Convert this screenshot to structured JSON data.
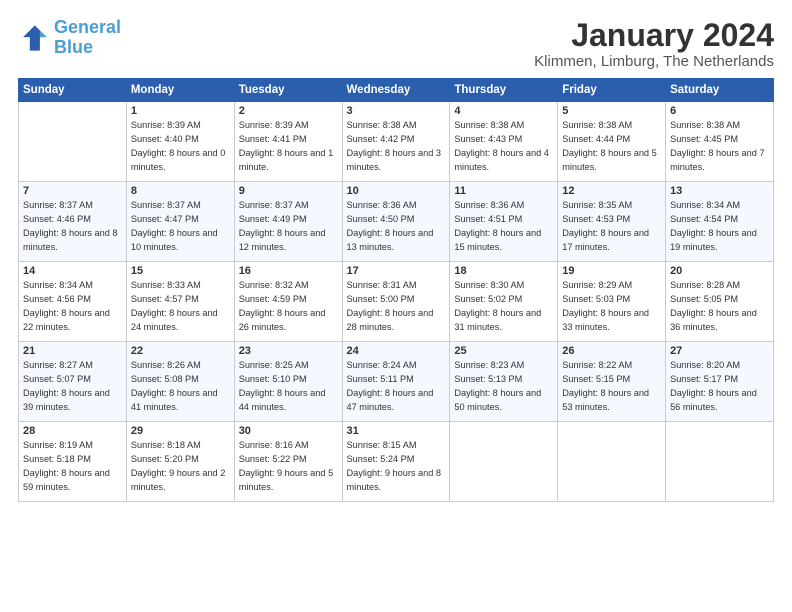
{
  "header": {
    "logo_line1": "General",
    "logo_line2": "Blue",
    "month_title": "January 2024",
    "location": "Klimmen, Limburg, The Netherlands"
  },
  "weekdays": [
    "Sunday",
    "Monday",
    "Tuesday",
    "Wednesday",
    "Thursday",
    "Friday",
    "Saturday"
  ],
  "weeks": [
    [
      {
        "day": "",
        "sunrise": "",
        "sunset": "",
        "daylight": ""
      },
      {
        "day": "1",
        "sunrise": "Sunrise: 8:39 AM",
        "sunset": "Sunset: 4:40 PM",
        "daylight": "Daylight: 8 hours and 0 minutes."
      },
      {
        "day": "2",
        "sunrise": "Sunrise: 8:39 AM",
        "sunset": "Sunset: 4:41 PM",
        "daylight": "Daylight: 8 hours and 1 minute."
      },
      {
        "day": "3",
        "sunrise": "Sunrise: 8:38 AM",
        "sunset": "Sunset: 4:42 PM",
        "daylight": "Daylight: 8 hours and 3 minutes."
      },
      {
        "day": "4",
        "sunrise": "Sunrise: 8:38 AM",
        "sunset": "Sunset: 4:43 PM",
        "daylight": "Daylight: 8 hours and 4 minutes."
      },
      {
        "day": "5",
        "sunrise": "Sunrise: 8:38 AM",
        "sunset": "Sunset: 4:44 PM",
        "daylight": "Daylight: 8 hours and 5 minutes."
      },
      {
        "day": "6",
        "sunrise": "Sunrise: 8:38 AM",
        "sunset": "Sunset: 4:45 PM",
        "daylight": "Daylight: 8 hours and 7 minutes."
      }
    ],
    [
      {
        "day": "7",
        "sunrise": "Sunrise: 8:37 AM",
        "sunset": "Sunset: 4:46 PM",
        "daylight": "Daylight: 8 hours and 8 minutes."
      },
      {
        "day": "8",
        "sunrise": "Sunrise: 8:37 AM",
        "sunset": "Sunset: 4:47 PM",
        "daylight": "Daylight: 8 hours and 10 minutes."
      },
      {
        "day": "9",
        "sunrise": "Sunrise: 8:37 AM",
        "sunset": "Sunset: 4:49 PM",
        "daylight": "Daylight: 8 hours and 12 minutes."
      },
      {
        "day": "10",
        "sunrise": "Sunrise: 8:36 AM",
        "sunset": "Sunset: 4:50 PM",
        "daylight": "Daylight: 8 hours and 13 minutes."
      },
      {
        "day": "11",
        "sunrise": "Sunrise: 8:36 AM",
        "sunset": "Sunset: 4:51 PM",
        "daylight": "Daylight: 8 hours and 15 minutes."
      },
      {
        "day": "12",
        "sunrise": "Sunrise: 8:35 AM",
        "sunset": "Sunset: 4:53 PM",
        "daylight": "Daylight: 8 hours and 17 minutes."
      },
      {
        "day": "13",
        "sunrise": "Sunrise: 8:34 AM",
        "sunset": "Sunset: 4:54 PM",
        "daylight": "Daylight: 8 hours and 19 minutes."
      }
    ],
    [
      {
        "day": "14",
        "sunrise": "Sunrise: 8:34 AM",
        "sunset": "Sunset: 4:56 PM",
        "daylight": "Daylight: 8 hours and 22 minutes."
      },
      {
        "day": "15",
        "sunrise": "Sunrise: 8:33 AM",
        "sunset": "Sunset: 4:57 PM",
        "daylight": "Daylight: 8 hours and 24 minutes."
      },
      {
        "day": "16",
        "sunrise": "Sunrise: 8:32 AM",
        "sunset": "Sunset: 4:59 PM",
        "daylight": "Daylight: 8 hours and 26 minutes."
      },
      {
        "day": "17",
        "sunrise": "Sunrise: 8:31 AM",
        "sunset": "Sunset: 5:00 PM",
        "daylight": "Daylight: 8 hours and 28 minutes."
      },
      {
        "day": "18",
        "sunrise": "Sunrise: 8:30 AM",
        "sunset": "Sunset: 5:02 PM",
        "daylight": "Daylight: 8 hours and 31 minutes."
      },
      {
        "day": "19",
        "sunrise": "Sunrise: 8:29 AM",
        "sunset": "Sunset: 5:03 PM",
        "daylight": "Daylight: 8 hours and 33 minutes."
      },
      {
        "day": "20",
        "sunrise": "Sunrise: 8:28 AM",
        "sunset": "Sunset: 5:05 PM",
        "daylight": "Daylight: 8 hours and 36 minutes."
      }
    ],
    [
      {
        "day": "21",
        "sunrise": "Sunrise: 8:27 AM",
        "sunset": "Sunset: 5:07 PM",
        "daylight": "Daylight: 8 hours and 39 minutes."
      },
      {
        "day": "22",
        "sunrise": "Sunrise: 8:26 AM",
        "sunset": "Sunset: 5:08 PM",
        "daylight": "Daylight: 8 hours and 41 minutes."
      },
      {
        "day": "23",
        "sunrise": "Sunrise: 8:25 AM",
        "sunset": "Sunset: 5:10 PM",
        "daylight": "Daylight: 8 hours and 44 minutes."
      },
      {
        "day": "24",
        "sunrise": "Sunrise: 8:24 AM",
        "sunset": "Sunset: 5:11 PM",
        "daylight": "Daylight: 8 hours and 47 minutes."
      },
      {
        "day": "25",
        "sunrise": "Sunrise: 8:23 AM",
        "sunset": "Sunset: 5:13 PM",
        "daylight": "Daylight: 8 hours and 50 minutes."
      },
      {
        "day": "26",
        "sunrise": "Sunrise: 8:22 AM",
        "sunset": "Sunset: 5:15 PM",
        "daylight": "Daylight: 8 hours and 53 minutes."
      },
      {
        "day": "27",
        "sunrise": "Sunrise: 8:20 AM",
        "sunset": "Sunset: 5:17 PM",
        "daylight": "Daylight: 8 hours and 56 minutes."
      }
    ],
    [
      {
        "day": "28",
        "sunrise": "Sunrise: 8:19 AM",
        "sunset": "Sunset: 5:18 PM",
        "daylight": "Daylight: 8 hours and 59 minutes."
      },
      {
        "day": "29",
        "sunrise": "Sunrise: 8:18 AM",
        "sunset": "Sunset: 5:20 PM",
        "daylight": "Daylight: 9 hours and 2 minutes."
      },
      {
        "day": "30",
        "sunrise": "Sunrise: 8:16 AM",
        "sunset": "Sunset: 5:22 PM",
        "daylight": "Daylight: 9 hours and 5 minutes."
      },
      {
        "day": "31",
        "sunrise": "Sunrise: 8:15 AM",
        "sunset": "Sunset: 5:24 PM",
        "daylight": "Daylight: 9 hours and 8 minutes."
      },
      {
        "day": "",
        "sunrise": "",
        "sunset": "",
        "daylight": ""
      },
      {
        "day": "",
        "sunrise": "",
        "sunset": "",
        "daylight": ""
      },
      {
        "day": "",
        "sunrise": "",
        "sunset": "",
        "daylight": ""
      }
    ]
  ]
}
